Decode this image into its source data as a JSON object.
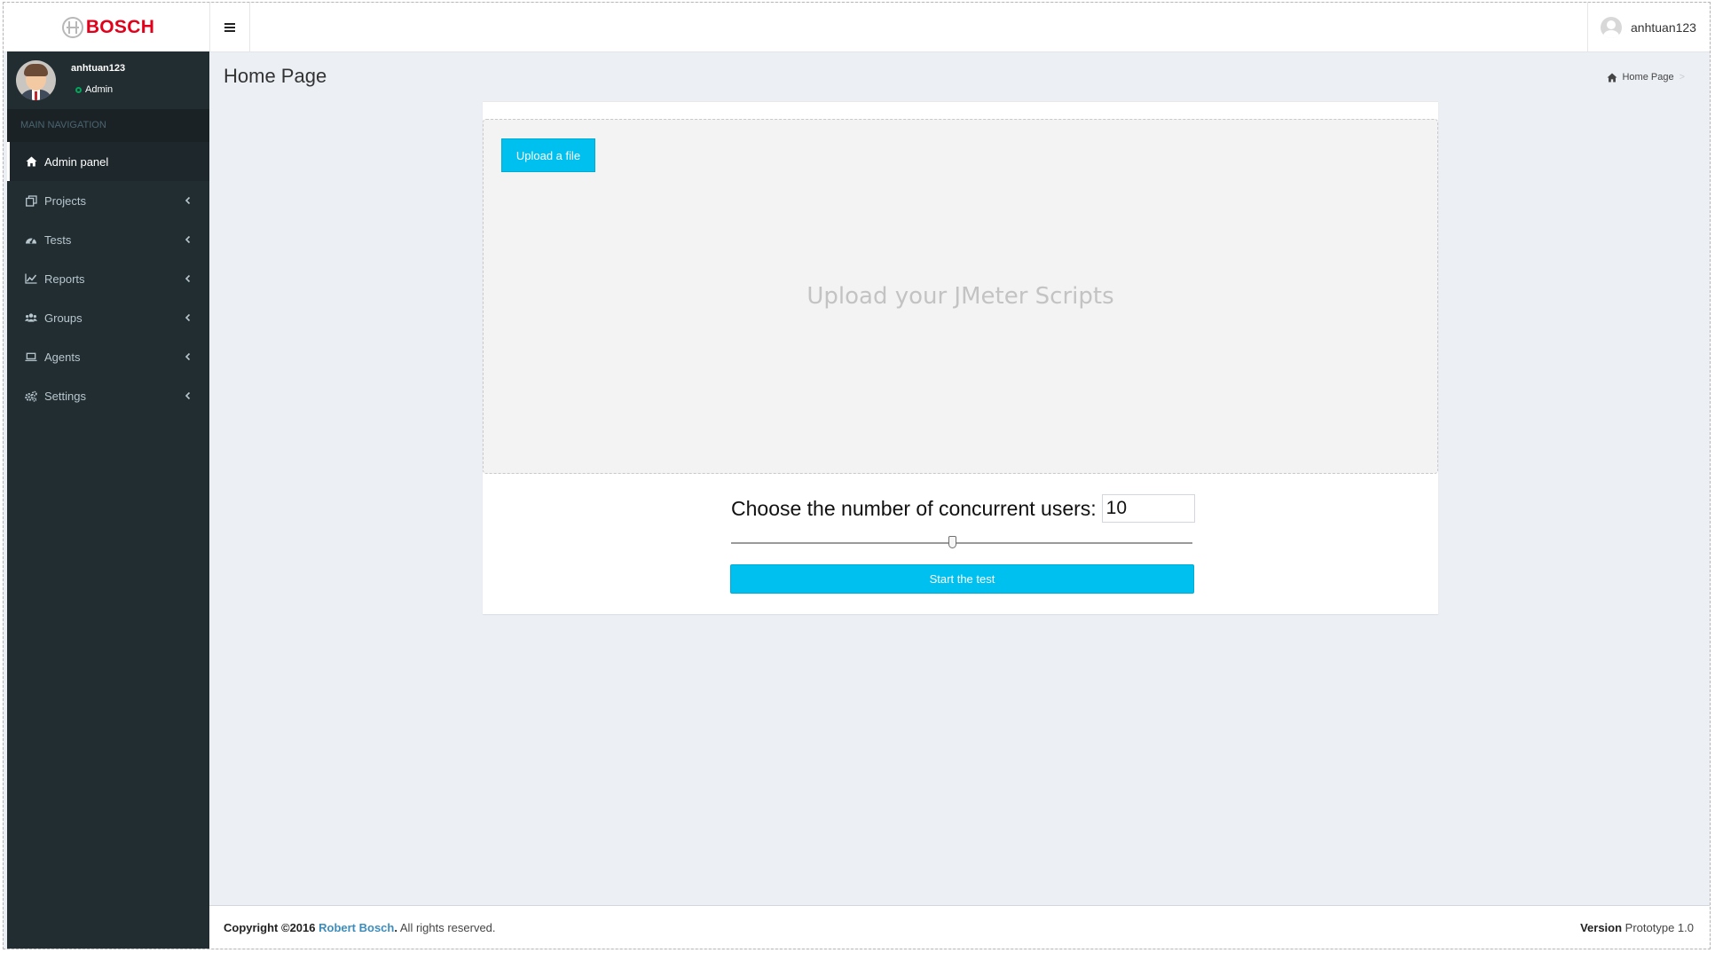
{
  "header": {
    "logo_text": "BOSCH",
    "user_name": "anhtuan123"
  },
  "sidebar": {
    "user": {
      "name": "anhtuan123",
      "role": "Admin"
    },
    "nav_header": "MAIN NAVIGATION",
    "items": [
      {
        "label": "Admin panel",
        "icon": "home-icon"
      },
      {
        "label": "Projects",
        "icon": "projects-icon"
      },
      {
        "label": "Tests",
        "icon": "tachometer-icon"
      },
      {
        "label": "Reports",
        "icon": "line-chart-icon"
      },
      {
        "label": "Groups",
        "icon": "users-icon"
      },
      {
        "label": "Agents",
        "icon": "laptop-icon"
      },
      {
        "label": "Settings",
        "icon": "gears-icon"
      }
    ]
  },
  "content": {
    "title": "Home Page",
    "breadcrumb": "Home Page",
    "upload_button": "Upload a file",
    "dropzone_message": "Upload your JMeter Scripts",
    "users_label": "Choose the number of concurrent users:",
    "users_value": "10",
    "slider_fraction": 0.48,
    "start_button": "Start the test"
  },
  "footer": {
    "copyright_prefix": "Copyright ©2016",
    "company": "Robert Bosch",
    "rights": ". All rights reserved.",
    "version_label": "Version",
    "version_value": "Prototype 1.0"
  },
  "colors": {
    "accent": "#00c0ef",
    "sidebar_bg": "#222d32",
    "brand_red": "#e2001a",
    "link": "#3c8dbc",
    "content_bg": "#ecf0f5"
  }
}
